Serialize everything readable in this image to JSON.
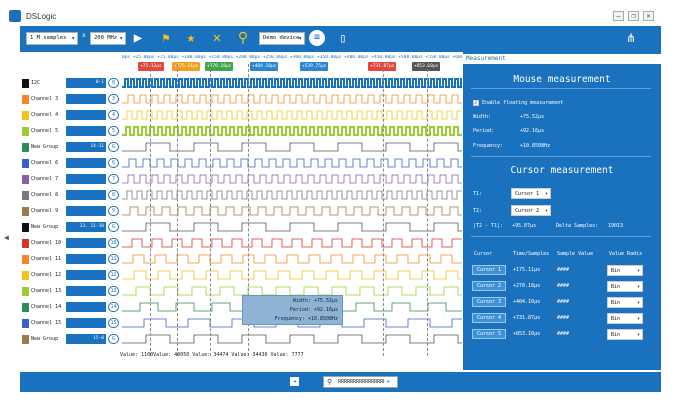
{
  "app": {
    "title": "DSLogic"
  },
  "window": {
    "min": "–",
    "max": "❐",
    "close": "✕"
  },
  "toolbar": {
    "samples": "1 M samples",
    "x": "x",
    "rate": "200 MHz",
    "device": "Demo device",
    "icons": [
      "play-icon",
      "flag-icon",
      "star-icon",
      "cross-icon",
      "search-icon",
      "settings-icon",
      "file-icon",
      "network-icon"
    ]
  },
  "ruler": {
    "text": "0ps  +25.00μs  +75.00μs  +100.00μs  +150.00μs  +200.00μs  +250.00μs  +300.00μs  +350.00μs  +400.00μs  +450.00μs  +500.00μs  +550.00μs  +600.00μs  +650.00μs  +700.00μs  +750.00μs  +800.00μs  +850.00μs  +900.00μs  +950.00μs"
  },
  "cursor_flags": [
    {
      "label": "+75.12μs",
      "color": "#e0473f"
    },
    {
      "label": "+175.11μs",
      "color": "#f0a020"
    },
    {
      "label": "+270.18μs",
      "color": "#3fa64a"
    },
    {
      "label": "+404.10μs",
      "color": "#2a86d0"
    },
    {
      "label": "+539.75μs",
      "color": "#2a86d0"
    },
    {
      "label": "+731.87μs",
      "color": "#e0473f"
    },
    {
      "label": "+853.10μs",
      "color": "#555555"
    }
  ],
  "channels": [
    {
      "name": "I2C",
      "color": "#111111",
      "trig": "0-1",
      "num": "0"
    },
    {
      "name": "Channel 3",
      "color": "#f08a24",
      "trig": "",
      "num": "3"
    },
    {
      "name": "Channel 4",
      "color": "#f2c419",
      "trig": "",
      "num": "4"
    },
    {
      "name": "Channel 5",
      "color": "#9acd32",
      "trig": "",
      "num": "5"
    },
    {
      "name": "New Group",
      "color": "#2e8b57",
      "trig": "14-11",
      "num": "G"
    },
    {
      "name": "Channel 6",
      "color": "#3a5fcd",
      "trig": "",
      "num": "6"
    },
    {
      "name": "Channel 7",
      "color": "#8b5fa8",
      "trig": "",
      "num": "7"
    },
    {
      "name": "Channel 8",
      "color": "#7a7a7a",
      "trig": "",
      "num": "8"
    },
    {
      "name": "Channel 9",
      "color": "#a0784a",
      "trig": "",
      "num": "9"
    },
    {
      "name": "New Group",
      "color": "#111111",
      "trig": "13, 11-10",
      "num": "G"
    },
    {
      "name": "Channel 10",
      "color": "#d9322d",
      "trig": "",
      "num": "10"
    },
    {
      "name": "Channel 11",
      "color": "#f08a24",
      "trig": "",
      "num": "11"
    },
    {
      "name": "Channel 12",
      "color": "#f2c419",
      "trig": "",
      "num": "12"
    },
    {
      "name": "Channel 13",
      "color": "#9acd32",
      "trig": "",
      "num": "13"
    },
    {
      "name": "Channel 14",
      "color": "#2e8b57",
      "trig": "",
      "num": "14"
    },
    {
      "name": "Channel 15",
      "color": "#3a5fcd",
      "trig": "",
      "num": "15"
    },
    {
      "name": "New Group",
      "color": "#a0784a",
      "trig": "15-0",
      "num": "G"
    }
  ],
  "meas_popup": {
    "width": "Width: +75.52μs",
    "period": "Period: +92.16μs",
    "freq": "Frequency: +10.8508Hz"
  },
  "values_bar": "Value: 1100Value: 40050     Value: 34474                                    Value: 34430     Value: 7777",
  "bottom": {
    "search_value": "RRRRRRRRRRRRRRRR",
    "prev": "◂",
    "next": "▸"
  },
  "panel": {
    "tab": "Measurement",
    "mouse_title": "Mouse measurement",
    "enable_label": "Enable floating measurement",
    "width_label": "Width:",
    "width_value": "+75.52μs",
    "period_label": "Period:",
    "period_value": "+92.16μs",
    "freq_label": "Frequency:",
    "freq_value": "+10.8508Hz",
    "cursor_title": "Cursor measurement",
    "t1_label": "T1:",
    "t1_value": "Cursor 1",
    "t2_label": "T2:",
    "t2_value": "Cursor 2",
    "delta_label": "|T2 - T1|:",
    "delta_value": "+95.07μs",
    "delta_samples_label": "Delta Samples:",
    "delta_samples_value": "19013",
    "headers": [
      "Cursor",
      "Time/Samples",
      "Sample Value",
      "Value Radix"
    ],
    "cursors": [
      {
        "label": "Cursor 1",
        "time": "+175.11μs",
        "value": "####",
        "radix": "Bin"
      },
      {
        "label": "Cursor 2",
        "time": "+270.18μs",
        "value": "####",
        "radix": "Bin"
      },
      {
        "label": "Cursor 3",
        "time": "+404.10μs",
        "value": "####",
        "radix": "Bin"
      },
      {
        "label": "Cursor 4",
        "time": "+731.87μs",
        "value": "####",
        "radix": "Bin"
      },
      {
        "label": "Cursor 5",
        "time": "+853.10μs",
        "value": "####",
        "radix": "Bin"
      }
    ]
  }
}
